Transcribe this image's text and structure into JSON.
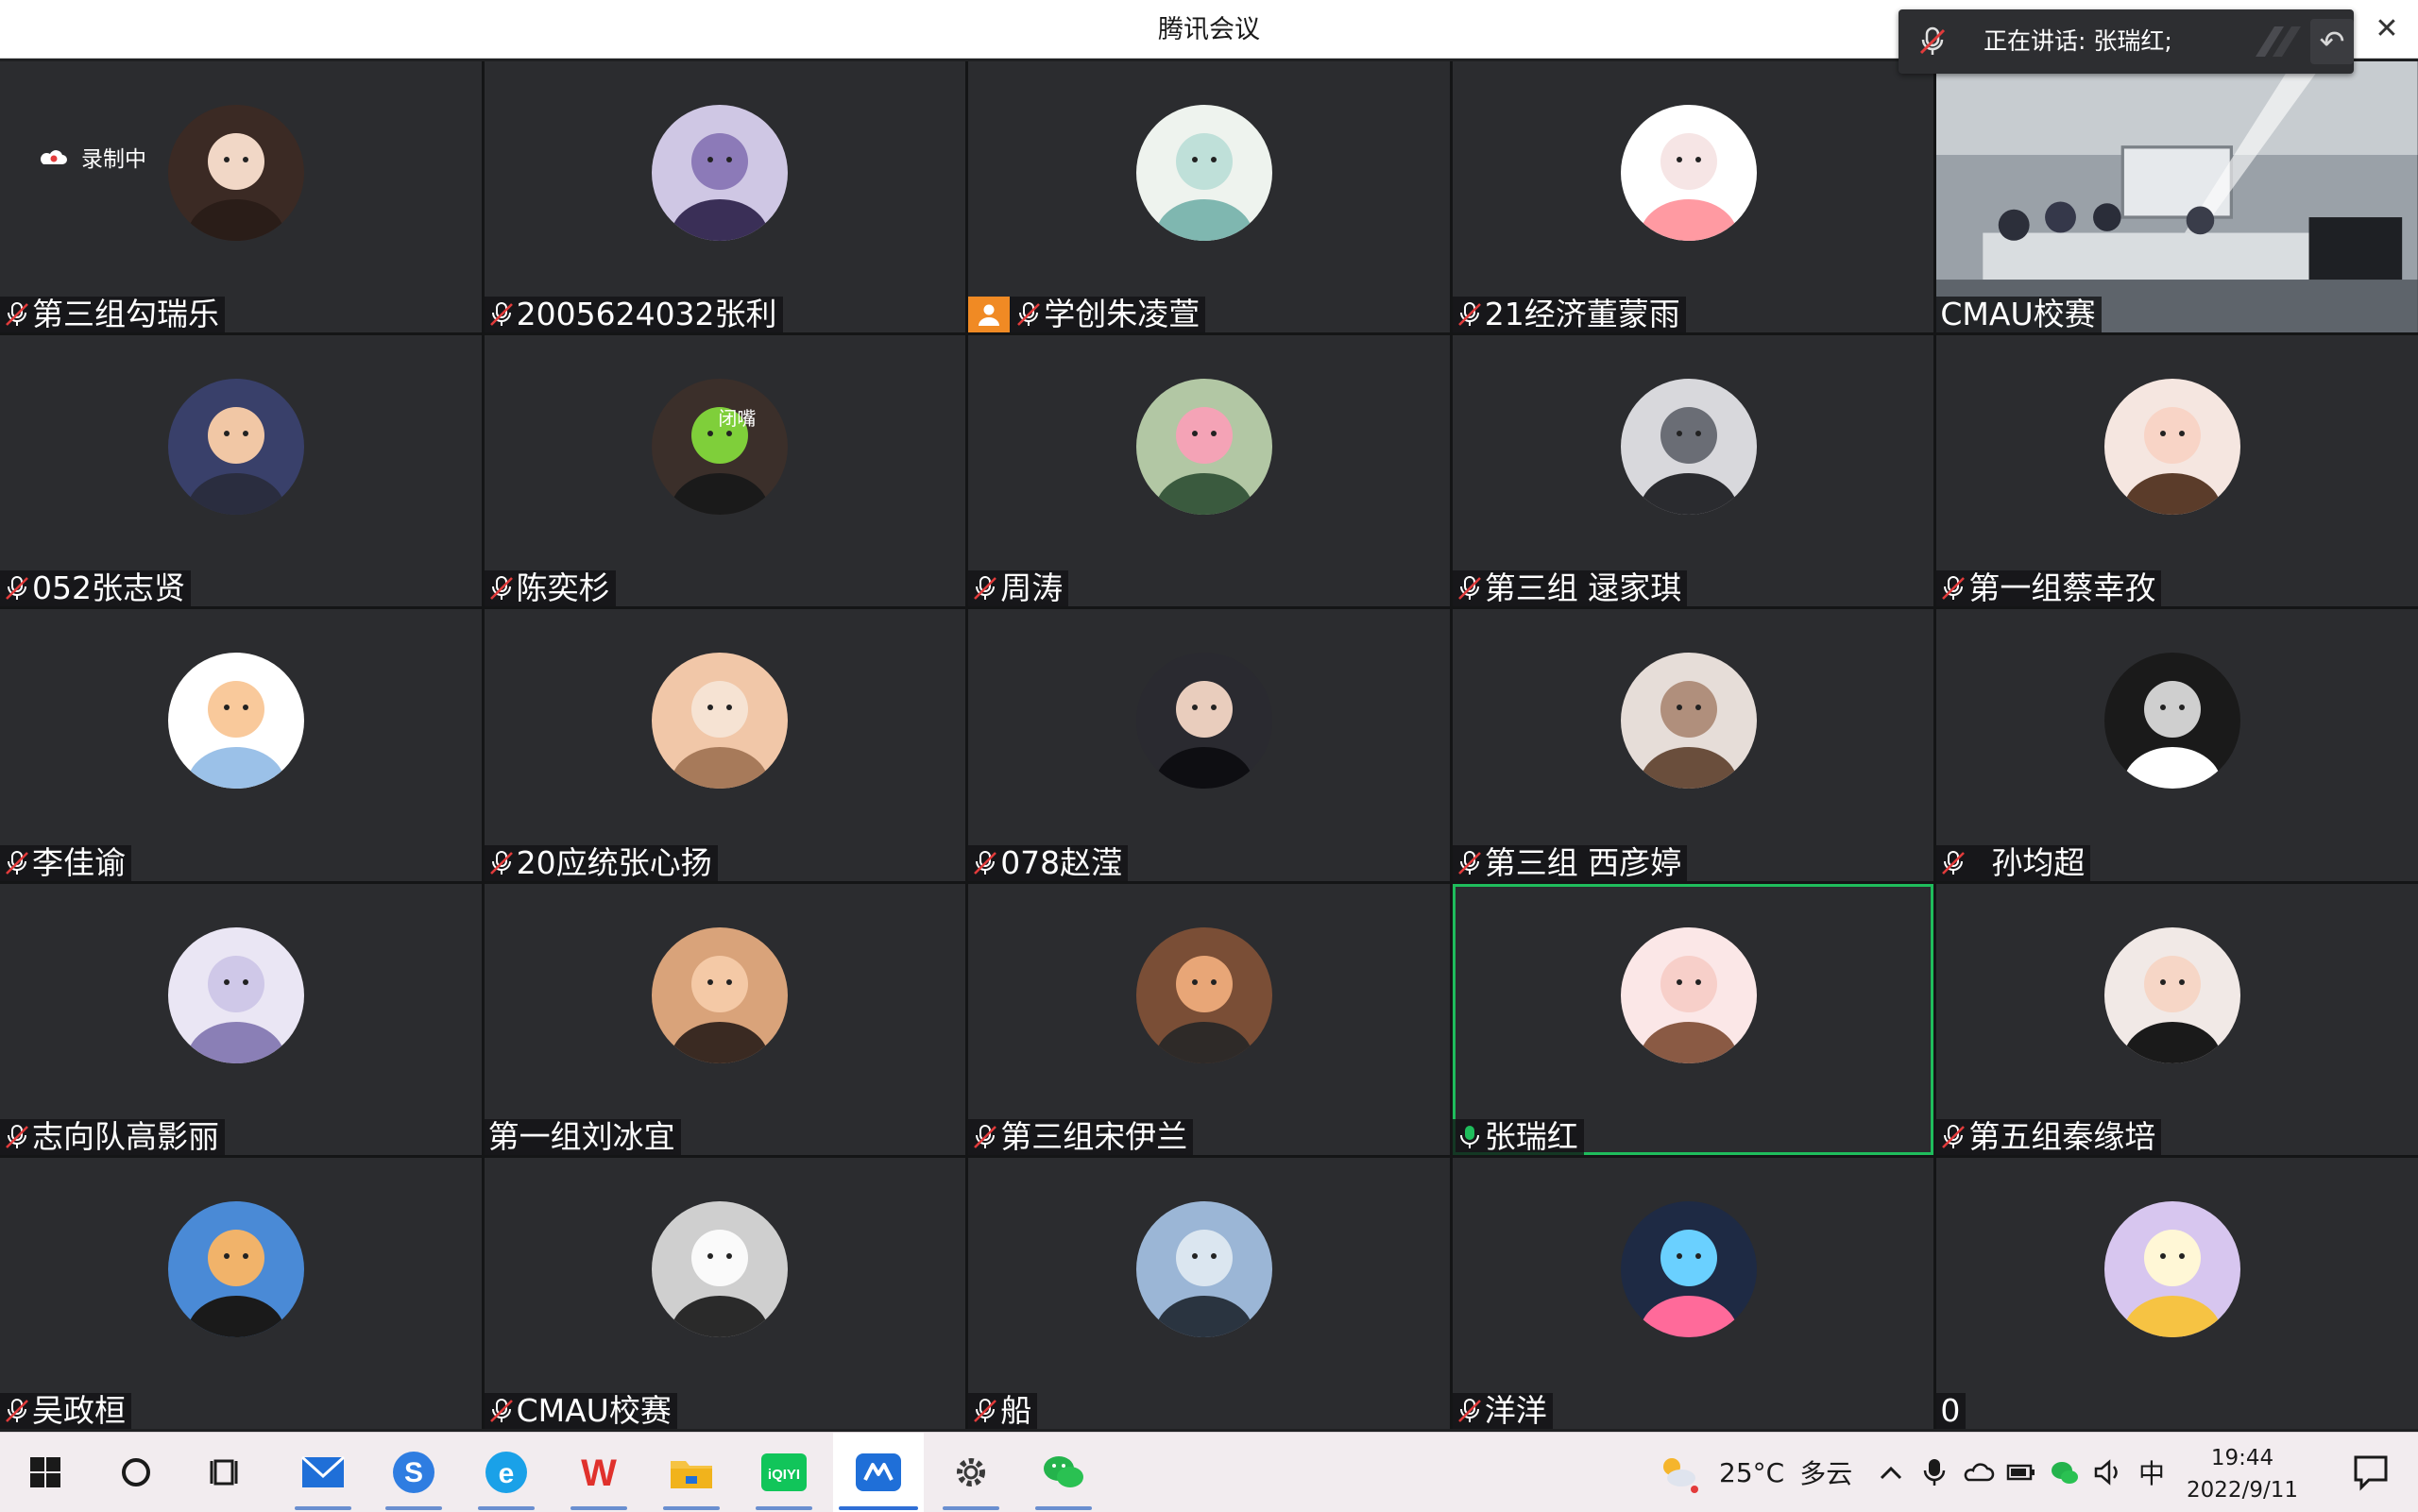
{
  "window": {
    "title": "腾讯会议",
    "close_label": "✕"
  },
  "speaking": {
    "label": "正在讲话: 张瑞红;"
  },
  "recording": {
    "label": "录制中"
  },
  "host_tile": {
    "name": "CMAU校赛"
  },
  "colors": {
    "tile_bg": "#2b2c2f",
    "active_speaker_border": "#1fbd5c",
    "host_badge": "#f08a24",
    "mic_muted": "#e23b3b",
    "mic_on": "#1fbd5c"
  },
  "participants": [
    {
      "name": "第三组勾瑞乐",
      "mic": "muted",
      "avatar": "bg1"
    },
    {
      "name": "2005624032张利",
      "mic": "muted",
      "avatar": "bg2"
    },
    {
      "name": "学创朱凌萱",
      "mic": "muted",
      "avatar": "bg3",
      "host_badge": true
    },
    {
      "name": "21经济董蒙雨",
      "mic": "muted",
      "avatar": "bg4"
    },
    {
      "name": "CMAU校赛",
      "mic": "none",
      "video": true
    },
    {
      "name": "052张志贤",
      "mic": "muted",
      "avatar": "bg5"
    },
    {
      "name": "陈奕杉",
      "mic": "muted",
      "avatar": "bg6",
      "avatar_text": "闭嘴"
    },
    {
      "name": "周涛",
      "mic": "muted",
      "avatar": "bg7"
    },
    {
      "name": "第三组 逯家琪",
      "mic": "muted",
      "avatar": "bg8"
    },
    {
      "name": "第一组蔡幸孜",
      "mic": "muted",
      "avatar": "bg9"
    },
    {
      "name": "李佳谕",
      "mic": "muted",
      "avatar": "bg10"
    },
    {
      "name": "20应统张心扬",
      "mic": "muted",
      "avatar": "bg11"
    },
    {
      "name": "078赵滢",
      "mic": "muted",
      "avatar": "bg12"
    },
    {
      "name": "第三组 西彦婷",
      "mic": "muted",
      "avatar": "bg13"
    },
    {
      "name": "孙均超",
      "mic": "muted",
      "avatar": "bg14"
    },
    {
      "name": "志向队高影丽",
      "mic": "muted",
      "avatar": "bg15"
    },
    {
      "name": "第一组刘冰宜",
      "mic": "none",
      "avatar": "bg16"
    },
    {
      "name": "第三组宋伊兰",
      "mic": "muted",
      "avatar": "bg17"
    },
    {
      "name": "张瑞红",
      "mic": "on",
      "avatar": "bg18",
      "active": true
    },
    {
      "name": "第五组秦缘培",
      "mic": "muted",
      "avatar": "bg19"
    },
    {
      "name": "吴政桓",
      "mic": "muted",
      "avatar": "bg20"
    },
    {
      "name": "CMAU校赛",
      "mic": "muted",
      "avatar": "bg21"
    },
    {
      "name": "船",
      "mic": "muted",
      "avatar": "bg22"
    },
    {
      "name": "洋洋",
      "mic": "muted",
      "avatar": "bg23"
    },
    {
      "name": "0",
      "mic": "none",
      "avatar": "bg24"
    }
  ],
  "taskbar": {
    "apps": [
      {
        "name": "start-menu-icon"
      },
      {
        "name": "cortana-search-icon"
      },
      {
        "name": "task-view-icon"
      },
      {
        "name": "mail-app-icon"
      },
      {
        "name": "sogou-input-icon"
      },
      {
        "name": "browser-app-icon"
      },
      {
        "name": "wps-office-icon"
      },
      {
        "name": "file-explorer-icon"
      },
      {
        "name": "iqiyi-app-icon",
        "label": "iQIYI"
      },
      {
        "name": "tencent-meeting-app-icon"
      },
      {
        "name": "settings-gear-icon"
      },
      {
        "name": "wechat-app-icon"
      }
    ],
    "weather": {
      "temp": "25°C",
      "condition": "多云"
    },
    "ime": "中",
    "time": "19:44",
    "date": "2022/9/11"
  }
}
